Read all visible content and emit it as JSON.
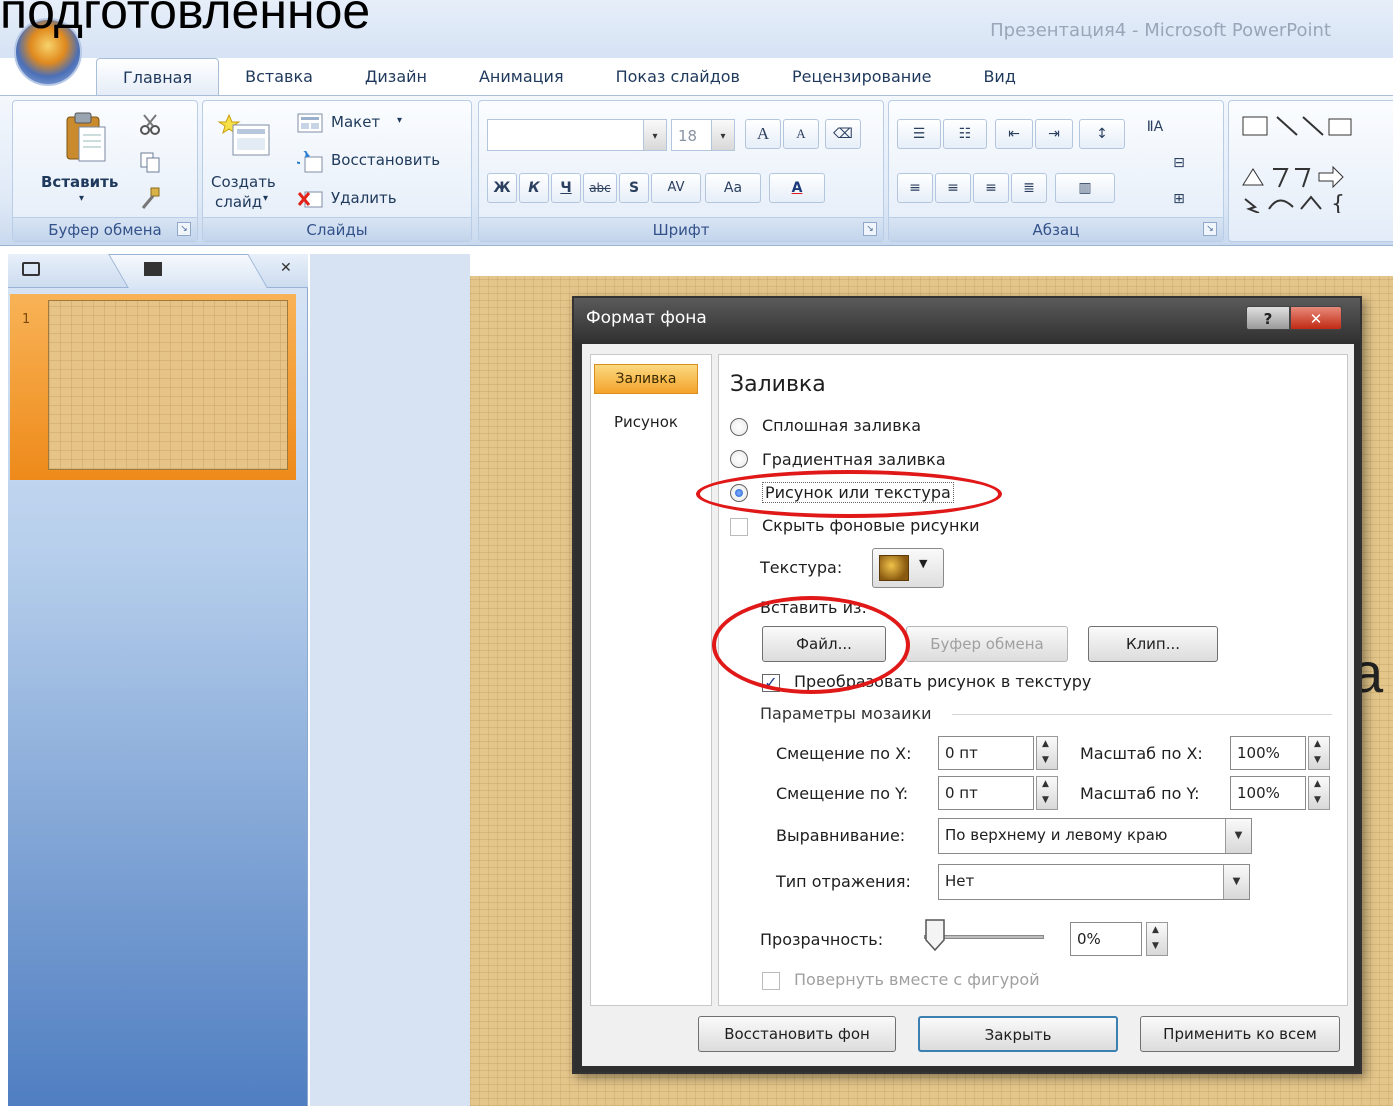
{
  "caption": "подготовленное",
  "window": {
    "title": "Презентация4 - Microsoft PowerPoint"
  },
  "tabs": [
    "Главная",
    "Вставка",
    "Дизайн",
    "Анимация",
    "Показ слайдов",
    "Рецензирование",
    "Вид"
  ],
  "ribbon": {
    "clipboard": {
      "paste_label": "Вставить",
      "group_label": "Буфер обмена"
    },
    "slides": {
      "new_slide_line1": "Создать",
      "new_slide_line2": "слайд",
      "layout_label": "Макет",
      "reset_label": "Восстановить",
      "delete_label": "Удалить",
      "group_label": "Слайды"
    },
    "font": {
      "font_size": "18",
      "group_label": "Шрифт",
      "bold": "Ж",
      "italic": "К",
      "underline": "Ч",
      "strike": "abc",
      "shadow": "S",
      "spacing": "AV",
      "case": "Aa",
      "color": "A",
      "grow": "A",
      "shrink": "A"
    },
    "paragraph": {
      "group_label": "Абзац"
    }
  },
  "slide_panel": {
    "slide_number": "1"
  },
  "slide": {
    "partial_text": "а"
  },
  "dialog": {
    "title": "Формат фона",
    "help": "?",
    "close": "✕",
    "nav": {
      "fill": "Заливка",
      "picture": "Рисунок"
    },
    "heading": "Заливка",
    "options": {
      "solid": "Сплошная заливка",
      "gradient": "Градиентная заливка",
      "picture_texture": "Рисунок или текстура",
      "hide_bg": "Скрыть фоновые рисунки"
    },
    "texture_label": "Текстура:",
    "insert_from_label": "Вставить из:",
    "buttons": {
      "file": "Файл...",
      "clipboard": "Буфер обмена",
      "clip": "Клип..."
    },
    "tile_check": "Преобразовать рисунок в текстуру",
    "tiling_heading": "Параметры мозаики",
    "offset_x_label": "Смещение по X:",
    "offset_x": "0 пт",
    "offset_y_label": "Смещение по Y:",
    "offset_y": "0 пт",
    "scale_x_label": "Масштаб по X:",
    "scale_x": "100%",
    "scale_y_label": "Масштаб по Y:",
    "scale_y": "100%",
    "align_label": "Выравнивание:",
    "align_value": "По верхнему и левому краю",
    "mirror_label": "Тип отражения:",
    "mirror_value": "Нет",
    "transparency_label": "Прозрачность:",
    "transparency_value": "0%",
    "transparency_level": 0,
    "rotate_check": "Повернуть вместе с фигурой",
    "footer": {
      "reset": "Восстановить фон",
      "close": "Закрыть",
      "apply_all": "Применить ко всем"
    }
  },
  "colors": {
    "highlight": "#e01818",
    "nav_selected": "#f4a32b"
  }
}
